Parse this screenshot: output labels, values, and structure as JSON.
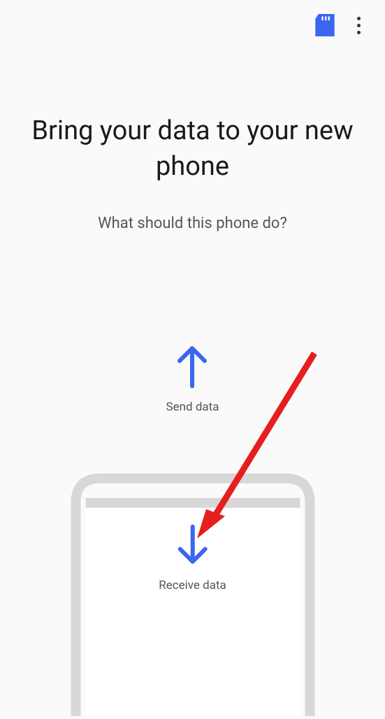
{
  "header": {
    "title": "Bring your data to your new phone",
    "subtitle": "What should this phone do?"
  },
  "options": {
    "send_label": "Send data",
    "receive_label": "Receive data"
  },
  "colors": {
    "accent": "#3a66f0",
    "annotation": "#e61e1e"
  }
}
